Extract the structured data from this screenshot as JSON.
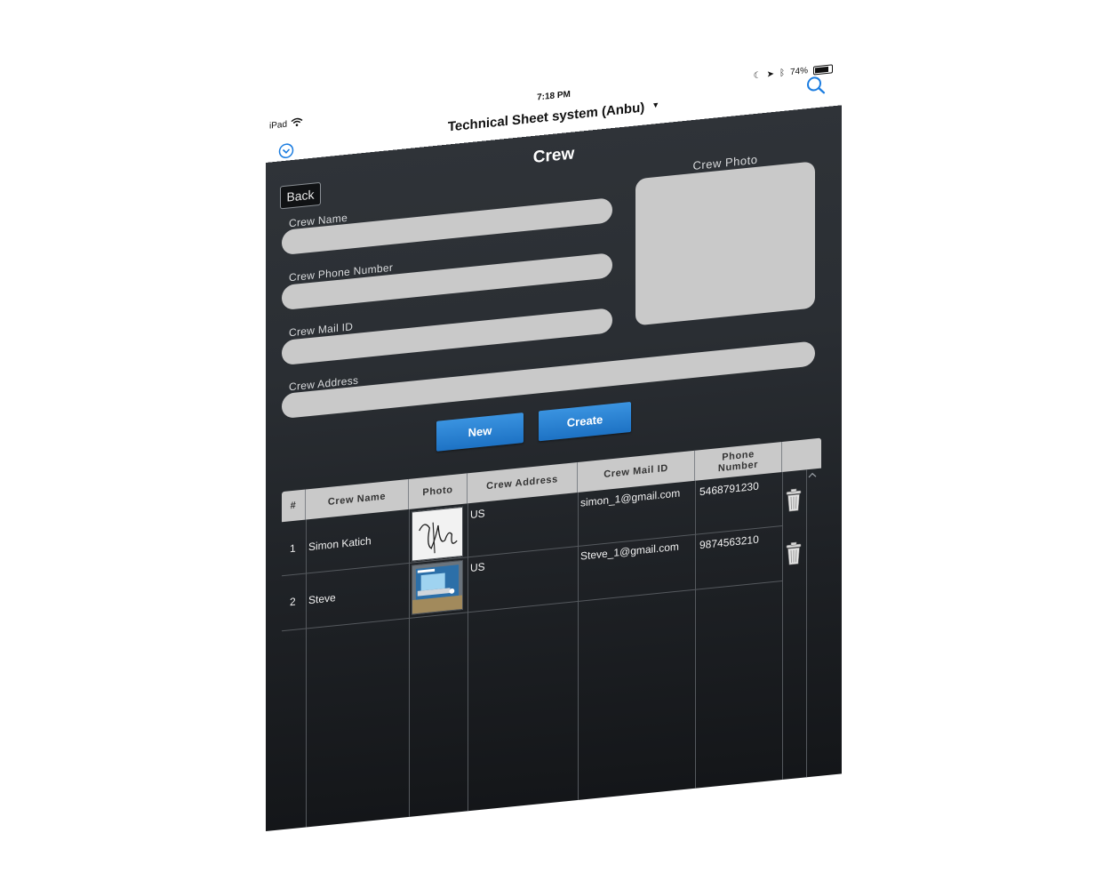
{
  "status_bar": {
    "carrier": "iPad",
    "time": "7:18 PM",
    "battery": "74%",
    "battery_level": 0.74
  },
  "header": {
    "app_title": "Technical Sheet system (Anbu)"
  },
  "screen": {
    "title": "Crew",
    "back_label": "Back"
  },
  "form": {
    "name_label": "Crew Name",
    "name_value": "",
    "phone_label": "Crew Phone Number",
    "phone_value": "",
    "mail_label": "Crew Mail ID",
    "mail_value": "",
    "address_label": "Crew Address",
    "address_value": "",
    "photo_label": "Crew Photo"
  },
  "actions": {
    "new_label": "New",
    "create_label": "Create"
  },
  "table": {
    "columns": [
      "#",
      "Crew Name",
      "Photo",
      "Crew Address",
      "Crew Mail ID",
      "Phone Number"
    ],
    "rows": [
      {
        "index": "1",
        "name": "Simon Katich",
        "photo": "signature-photo",
        "address": "US",
        "mail": "simon_1@gmail.com",
        "phone": "5468791230"
      },
      {
        "index": "2",
        "name": "Steve",
        "photo": "laptop-box-photo",
        "address": "US",
        "mail": "Steve_1@gmail.com",
        "phone": "9874563210"
      }
    ]
  },
  "colors": {
    "accent": "#1d72c4",
    "field": "#c9c9c9",
    "background": "#2a2e33"
  }
}
